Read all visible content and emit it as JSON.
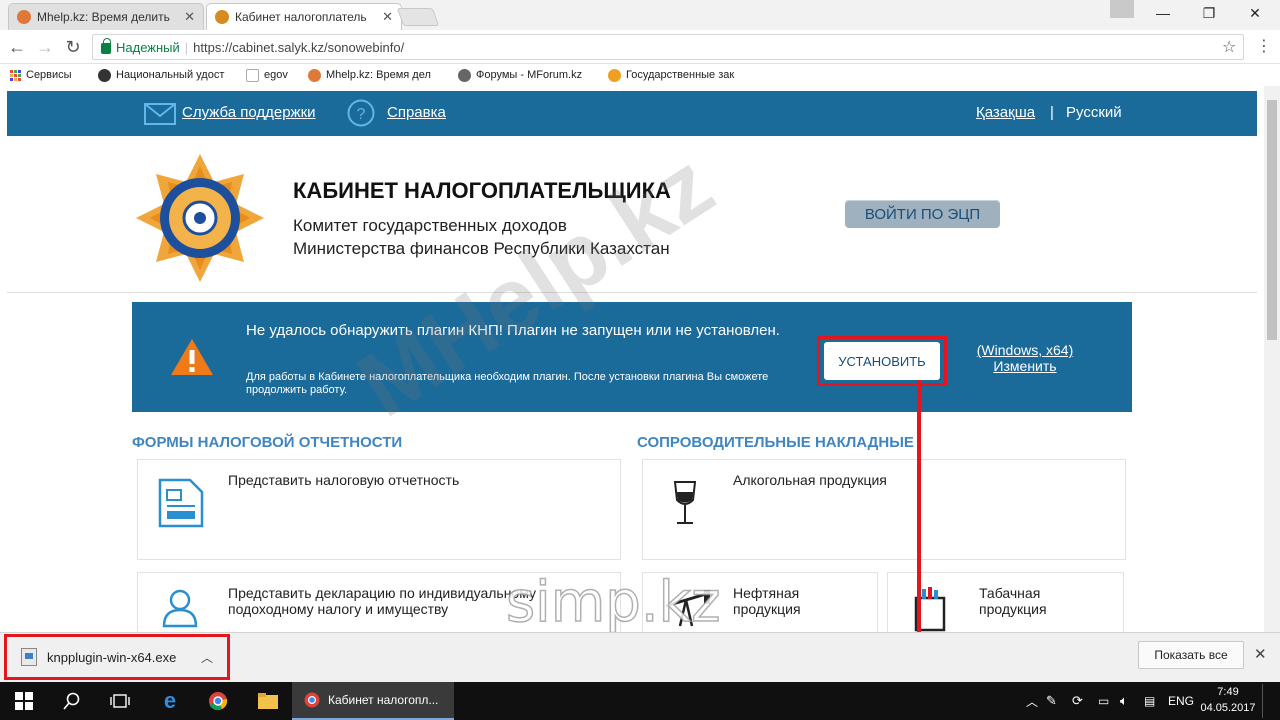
{
  "browser": {
    "tabs": [
      {
        "title": "Mhelp.kz: Время делить"
      },
      {
        "title": "Кабинет налогоплатель"
      }
    ],
    "secure_label": "Надежный",
    "url": "https://cabinet.salyk.kz/sonowebinfo/",
    "bookmarks": [
      {
        "label": "Сервисы"
      },
      {
        "label": "Национальный удост"
      },
      {
        "label": "egov"
      },
      {
        "label": "Mhelp.kz: Время дел"
      },
      {
        "label": "Форумы - MForum.kz"
      },
      {
        "label": "Государственные зак"
      }
    ]
  },
  "site": {
    "support": "Служба поддержки",
    "help": "Справка",
    "lang_kz": "Қазақша",
    "lang_sep": "|",
    "lang_ru": "Русский",
    "title": "КАБИНЕТ НАЛОГОПЛАТЕЛЬЩИКА",
    "subtitle1": "Комитет государственных доходов",
    "subtitle2": "Министерства финансов Республики Казахстан",
    "login_button": "ВОЙТИ ПО ЭЦП"
  },
  "alert": {
    "main": "Не удалось обнаружить плагин КНП! Плагин не запущен или не установлен.",
    "sub": "Для работы в Кабинете налогоплательщика необходим плагин. После установки плагина Вы сможете продолжить работу.",
    "install_button": "УСТАНОВИТЬ",
    "platform_link": "(Windows, x64)",
    "change_link": "Изменить"
  },
  "sections": {
    "left_title": "ФОРМЫ НАЛОГОВОЙ ОТЧЕТНОСТИ",
    "right_title": "СОПРОВОДИТЕЛЬНЫЕ НАКЛАДНЫЕ",
    "cards": {
      "report": "Представить налоговую отчетность",
      "alcohol": "Алкогольная продукция",
      "declaration": "Представить декларацию по индивидуальному подоходному налогу и имуществу",
      "oil": "Нефтяная продукция",
      "tobacco": "Табачная продукция"
    }
  },
  "watermarks": {
    "big": "MHelp.kz",
    "small": "simp.kz"
  },
  "download": {
    "filename": "knpplugin-win-x64.exe",
    "show_all": "Показать все"
  },
  "taskbar": {
    "active_window": "Кабинет налогопл...",
    "lang": "ENG",
    "time": "7:49",
    "date": "04.05.2017"
  },
  "colors": {
    "site_blue": "#1a6a9a",
    "section_blue": "#3f86c0",
    "highlight_red": "#e4151c"
  }
}
